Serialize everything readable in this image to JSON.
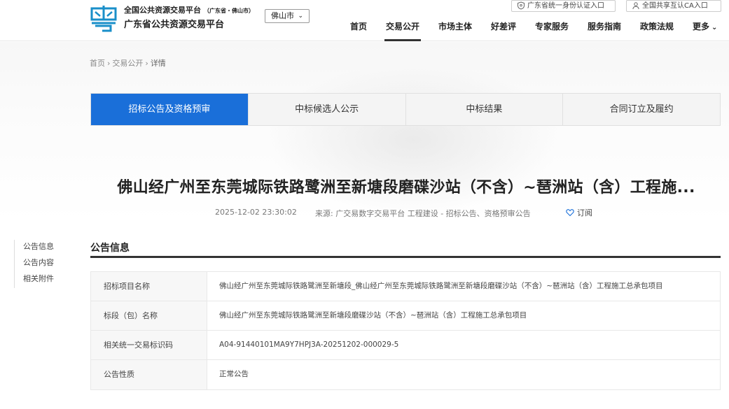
{
  "header": {
    "brand_line1": "全国公共资源交易平台",
    "brand_line1_sub": "（广东省・佛山市）",
    "brand_line2": "广东省公共资源交易平台",
    "city": "佛山市",
    "top_links": {
      "id_portal": "广东省统一身份认证入口",
      "ca_portal": "全国共享互认CA入口"
    },
    "nav": [
      "首页",
      "交易公开",
      "市场主体",
      "好差评",
      "专家服务",
      "服务指南",
      "政策法规",
      "更多"
    ],
    "nav_active": "交易公开",
    "brand_color": "#1a6fd9"
  },
  "breadcrumb": [
    "首页",
    "交易公开",
    "详情"
  ],
  "tabs": [
    "招标公告及资格预审",
    "中标候选人公示",
    "中标结果",
    "合同订立及履约"
  ],
  "tab_active": "招标公告及资格预审",
  "article": {
    "title": "佛山经广州至东莞城际铁路鹭洲至新塘段磨碟沙站（不含）~琶洲站（含）工程施...",
    "date": "2025-12-02 23:30:02",
    "source": "来源: 广交易数字交易平台 工程建设 - 招标公告、资格预审公告",
    "subscribe": "订阅"
  },
  "sidebar": [
    "公告信息",
    "公告内容",
    "相关附件"
  ],
  "section": {
    "title": "公告信息",
    "rows": [
      {
        "key": "招标项目名称",
        "value": "佛山经广州至东莞城际铁路鹭洲至新塘段_佛山经广州至东莞城际铁路鹭洲至新塘段磨碟沙站（不含）~琶洲站（含）工程施工总承包项目"
      },
      {
        "key": "标段（包）名称",
        "value": "佛山经广州至东莞城际铁路鹭洲至新塘段磨碟沙站（不含）~琶洲站（含）工程施工总承包项目"
      },
      {
        "key": "相关统一交易标识码",
        "value": "A04-91440101MA9Y7HPJ3A-20251202-000029-5"
      },
      {
        "key": "公告性质",
        "value": "正常公告"
      }
    ]
  }
}
